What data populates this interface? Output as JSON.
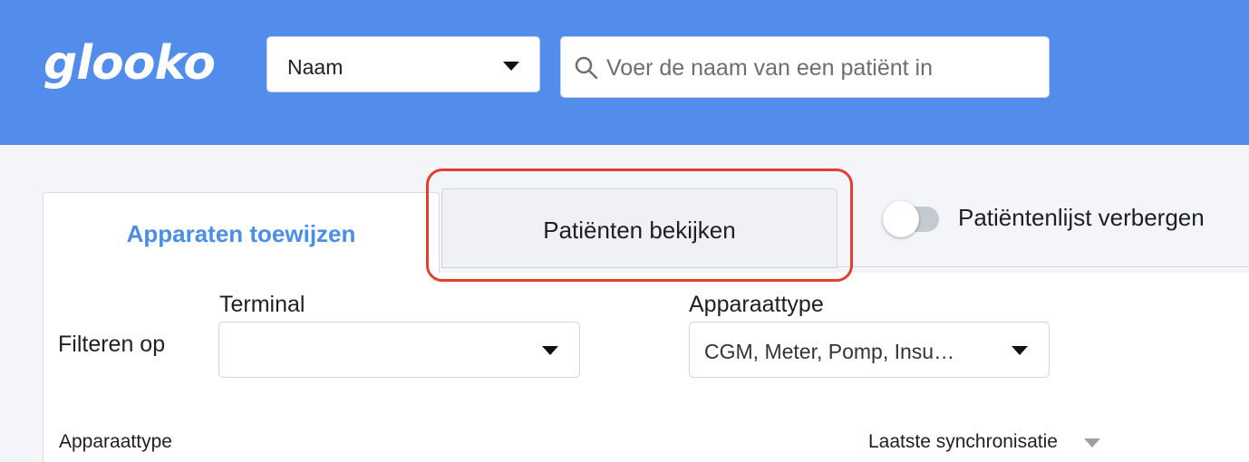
{
  "header": {
    "logo_text": "glooko",
    "search_by_select": {
      "value": "Naam"
    },
    "search": {
      "placeholder": "Voer de naam van een patiënt in"
    }
  },
  "tabs": [
    {
      "label": "Apparaten toewijzen",
      "active": true
    },
    {
      "label": "Patiënten bekijken",
      "active": false
    }
  ],
  "toggle": {
    "label": "Patiëntenlijst verbergen",
    "on": false
  },
  "filters": {
    "label": "Filteren op",
    "terminal": {
      "label": "Terminal",
      "value": ""
    },
    "device_type": {
      "label": "Apparaattype",
      "value": "CGM, Meter, Pomp, Insu…"
    }
  },
  "table": {
    "columns": [
      "Apparaattype",
      "Laatste synchronisatie"
    ]
  },
  "colors": {
    "header_bg": "#528deb",
    "active_tab_text": "#4b8ee6",
    "highlight_border": "#e0402f"
  }
}
